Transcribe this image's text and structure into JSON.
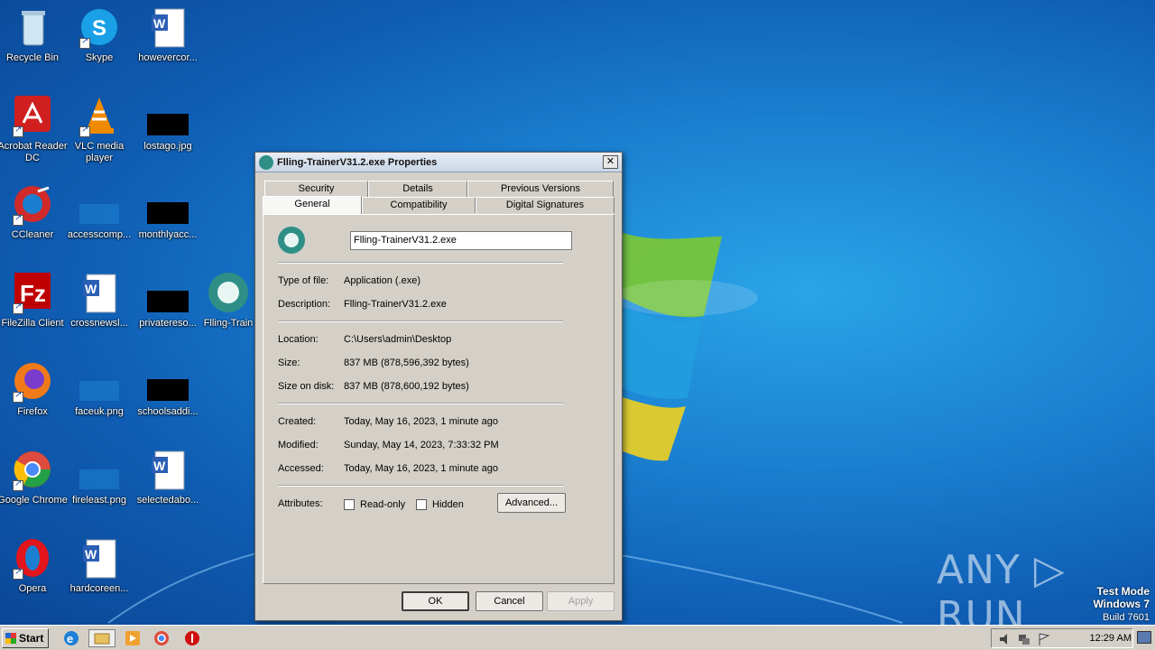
{
  "desktop": {
    "icons": [
      {
        "label": "Recycle Bin"
      },
      {
        "label": "Skype"
      },
      {
        "label": "howevercor..."
      },
      {
        "label": "Acrobat Reader DC"
      },
      {
        "label": "VLC media player"
      },
      {
        "label": "lostago.jpg"
      },
      {
        "label": "CCleaner"
      },
      {
        "label": "accesscomp..."
      },
      {
        "label": "monthlyacc..."
      },
      {
        "label": "FileZilla Client"
      },
      {
        "label": "crossnewsl..."
      },
      {
        "label": "privatereso..."
      },
      {
        "label": "Flling-Train"
      },
      {
        "label": "Firefox"
      },
      {
        "label": "faceuk.png"
      },
      {
        "label": "schoolsaddi..."
      },
      {
        "label": "Google Chrome"
      },
      {
        "label": "fireleast.png"
      },
      {
        "label": "selectedabo..."
      },
      {
        "label": "Opera"
      },
      {
        "label": "hardcoreen..."
      }
    ]
  },
  "dialog": {
    "title": "Flling-TrainerV31.2.exe Properties",
    "close": "✕",
    "tabs_back": [
      "Security",
      "Details",
      "Previous Versions"
    ],
    "tabs_front": [
      "General",
      "Compatibility",
      "Digital Signatures"
    ],
    "filename": "Flling-TrainerV31.2.exe",
    "props": {
      "type_label": "Type of file:",
      "type_value": "Application (.exe)",
      "desc_label": "Description:",
      "desc_value": "Flling-TrainerV31.2.exe",
      "location_label": "Location:",
      "location_value": "C:\\Users\\admin\\Desktop",
      "size_label": "Size:",
      "size_value": "837 MB (878,596,392 bytes)",
      "disk_label": "Size on disk:",
      "disk_value": "837 MB (878,600,192 bytes)",
      "created_label": "Created:",
      "created_value": "Today, May 16, 2023, 1 minute ago",
      "modified_label": "Modified:",
      "modified_value": "Sunday, May 14, 2023, 7:33:32 PM",
      "accessed_label": "Accessed:",
      "accessed_value": "Today, May 16, 2023, 1 minute ago",
      "attributes_label": "Attributes:",
      "readonly_label": "Read-only",
      "hidden_label": "Hidden",
      "advanced_label": "Advanced..."
    },
    "buttons": {
      "ok": "OK",
      "cancel": "Cancel",
      "apply": "Apply"
    }
  },
  "taskbar": {
    "start": "Start",
    "clock": "12:29 AM"
  },
  "watermark": {
    "line1": "Test Mode",
    "line2": "Windows 7",
    "line3": "Build 7601",
    "brand": "ANY ▷ RUN"
  }
}
